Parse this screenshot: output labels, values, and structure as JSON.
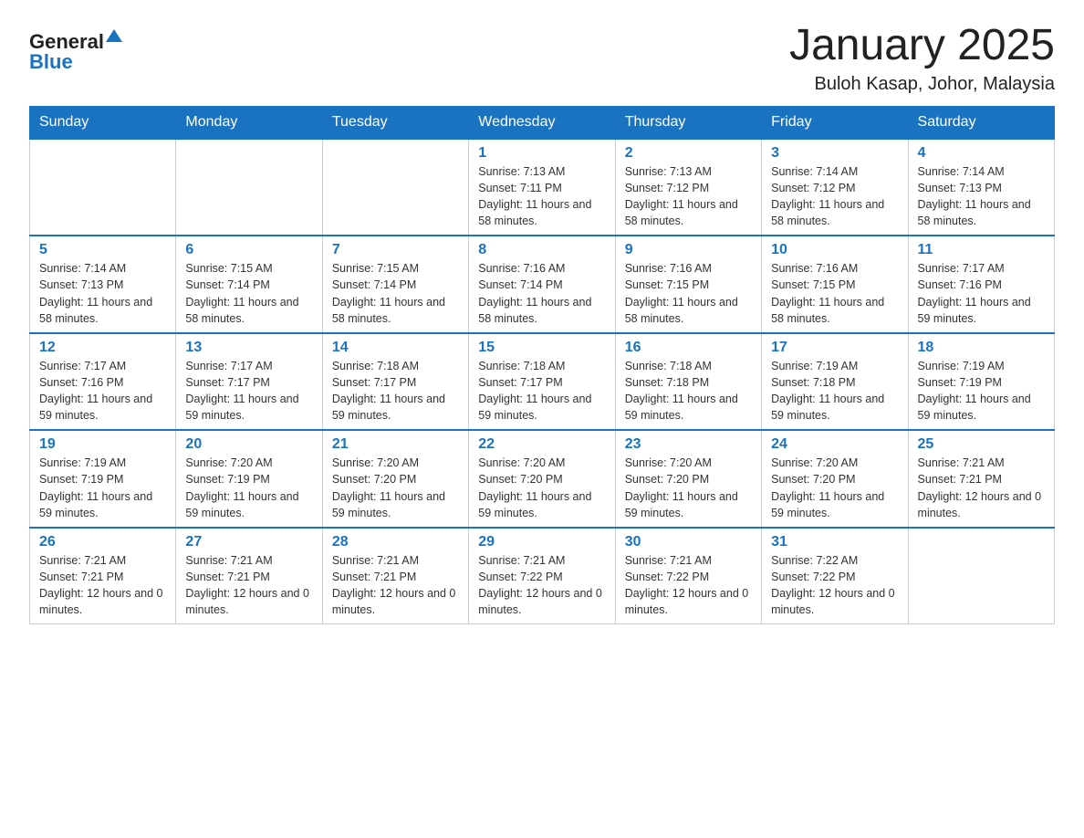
{
  "header": {
    "logo_general": "General",
    "logo_blue": "Blue",
    "month_title": "January 2025",
    "location": "Buloh Kasap, Johor, Malaysia"
  },
  "weekdays": [
    "Sunday",
    "Monday",
    "Tuesday",
    "Wednesday",
    "Thursday",
    "Friday",
    "Saturday"
  ],
  "weeks": [
    [
      {
        "day": "",
        "info": ""
      },
      {
        "day": "",
        "info": ""
      },
      {
        "day": "",
        "info": ""
      },
      {
        "day": "1",
        "info": "Sunrise: 7:13 AM\nSunset: 7:11 PM\nDaylight: 11 hours\nand 58 minutes."
      },
      {
        "day": "2",
        "info": "Sunrise: 7:13 AM\nSunset: 7:12 PM\nDaylight: 11 hours\nand 58 minutes."
      },
      {
        "day": "3",
        "info": "Sunrise: 7:14 AM\nSunset: 7:12 PM\nDaylight: 11 hours\nand 58 minutes."
      },
      {
        "day": "4",
        "info": "Sunrise: 7:14 AM\nSunset: 7:13 PM\nDaylight: 11 hours\nand 58 minutes."
      }
    ],
    [
      {
        "day": "5",
        "info": "Sunrise: 7:14 AM\nSunset: 7:13 PM\nDaylight: 11 hours\nand 58 minutes."
      },
      {
        "day": "6",
        "info": "Sunrise: 7:15 AM\nSunset: 7:14 PM\nDaylight: 11 hours\nand 58 minutes."
      },
      {
        "day": "7",
        "info": "Sunrise: 7:15 AM\nSunset: 7:14 PM\nDaylight: 11 hours\nand 58 minutes."
      },
      {
        "day": "8",
        "info": "Sunrise: 7:16 AM\nSunset: 7:14 PM\nDaylight: 11 hours\nand 58 minutes."
      },
      {
        "day": "9",
        "info": "Sunrise: 7:16 AM\nSunset: 7:15 PM\nDaylight: 11 hours\nand 58 minutes."
      },
      {
        "day": "10",
        "info": "Sunrise: 7:16 AM\nSunset: 7:15 PM\nDaylight: 11 hours\nand 58 minutes."
      },
      {
        "day": "11",
        "info": "Sunrise: 7:17 AM\nSunset: 7:16 PM\nDaylight: 11 hours\nand 59 minutes."
      }
    ],
    [
      {
        "day": "12",
        "info": "Sunrise: 7:17 AM\nSunset: 7:16 PM\nDaylight: 11 hours\nand 59 minutes."
      },
      {
        "day": "13",
        "info": "Sunrise: 7:17 AM\nSunset: 7:17 PM\nDaylight: 11 hours\nand 59 minutes."
      },
      {
        "day": "14",
        "info": "Sunrise: 7:18 AM\nSunset: 7:17 PM\nDaylight: 11 hours\nand 59 minutes."
      },
      {
        "day": "15",
        "info": "Sunrise: 7:18 AM\nSunset: 7:17 PM\nDaylight: 11 hours\nand 59 minutes."
      },
      {
        "day": "16",
        "info": "Sunrise: 7:18 AM\nSunset: 7:18 PM\nDaylight: 11 hours\nand 59 minutes."
      },
      {
        "day": "17",
        "info": "Sunrise: 7:19 AM\nSunset: 7:18 PM\nDaylight: 11 hours\nand 59 minutes."
      },
      {
        "day": "18",
        "info": "Sunrise: 7:19 AM\nSunset: 7:19 PM\nDaylight: 11 hours\nand 59 minutes."
      }
    ],
    [
      {
        "day": "19",
        "info": "Sunrise: 7:19 AM\nSunset: 7:19 PM\nDaylight: 11 hours\nand 59 minutes."
      },
      {
        "day": "20",
        "info": "Sunrise: 7:20 AM\nSunset: 7:19 PM\nDaylight: 11 hours\nand 59 minutes."
      },
      {
        "day": "21",
        "info": "Sunrise: 7:20 AM\nSunset: 7:20 PM\nDaylight: 11 hours\nand 59 minutes."
      },
      {
        "day": "22",
        "info": "Sunrise: 7:20 AM\nSunset: 7:20 PM\nDaylight: 11 hours\nand 59 minutes."
      },
      {
        "day": "23",
        "info": "Sunrise: 7:20 AM\nSunset: 7:20 PM\nDaylight: 11 hours\nand 59 minutes."
      },
      {
        "day": "24",
        "info": "Sunrise: 7:20 AM\nSunset: 7:20 PM\nDaylight: 11 hours\nand 59 minutes."
      },
      {
        "day": "25",
        "info": "Sunrise: 7:21 AM\nSunset: 7:21 PM\nDaylight: 12 hours\nand 0 minutes."
      }
    ],
    [
      {
        "day": "26",
        "info": "Sunrise: 7:21 AM\nSunset: 7:21 PM\nDaylight: 12 hours\nand 0 minutes."
      },
      {
        "day": "27",
        "info": "Sunrise: 7:21 AM\nSunset: 7:21 PM\nDaylight: 12 hours\nand 0 minutes."
      },
      {
        "day": "28",
        "info": "Sunrise: 7:21 AM\nSunset: 7:21 PM\nDaylight: 12 hours\nand 0 minutes."
      },
      {
        "day": "29",
        "info": "Sunrise: 7:21 AM\nSunset: 7:22 PM\nDaylight: 12 hours\nand 0 minutes."
      },
      {
        "day": "30",
        "info": "Sunrise: 7:21 AM\nSunset: 7:22 PM\nDaylight: 12 hours\nand 0 minutes."
      },
      {
        "day": "31",
        "info": "Sunrise: 7:22 AM\nSunset: 7:22 PM\nDaylight: 12 hours\nand 0 minutes."
      },
      {
        "day": "",
        "info": ""
      }
    ]
  ]
}
